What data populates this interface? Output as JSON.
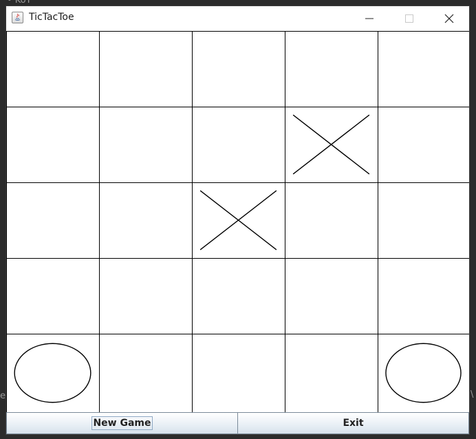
{
  "background": {
    "label_top": "• KoT",
    "label_left": "e",
    "label_right": "\\"
  },
  "window": {
    "title": "TicTacToe",
    "app_icon": "java-icon",
    "controls": [
      "minimize-icon",
      "maximize-icon",
      "close-icon"
    ]
  },
  "board": {
    "rows": 5,
    "cols": 5,
    "cells": [
      [
        "",
        "",
        "",
        "",
        ""
      ],
      [
        "",
        "",
        "",
        "X",
        ""
      ],
      [
        "",
        "",
        "X",
        "",
        ""
      ],
      [
        "",
        "",
        "",
        "",
        ""
      ],
      [
        "O",
        "",
        "",
        "",
        "O"
      ]
    ]
  },
  "buttons": {
    "new_game": "New Game",
    "exit": "Exit"
  },
  "colors": {
    "grid": "#000000",
    "window_bg": "#ffffff",
    "desktop_bg": "#2b2b2b"
  }
}
